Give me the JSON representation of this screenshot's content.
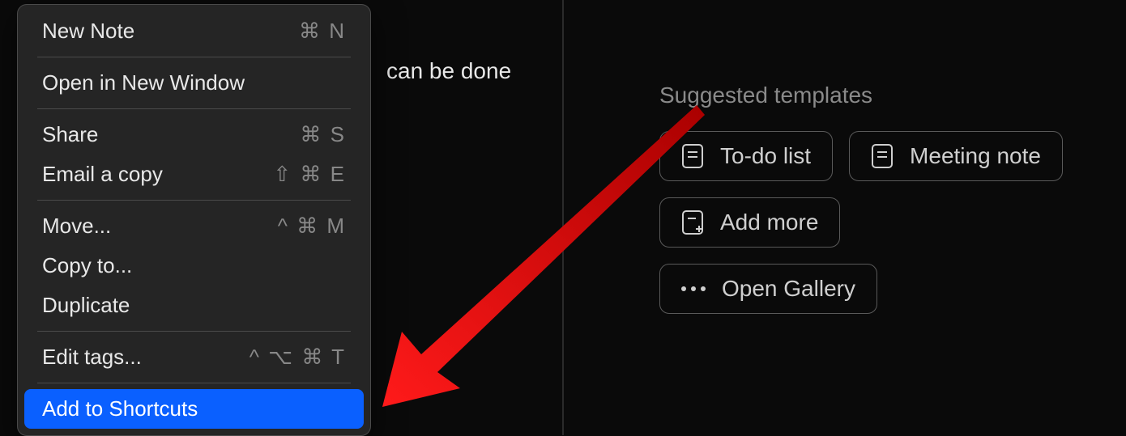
{
  "background": {
    "visible_text_fragment": "can be done"
  },
  "context_menu": {
    "items": [
      {
        "label": "New Note",
        "shortcut": "⌘ N"
      },
      {
        "separator": true
      },
      {
        "label": "Open in New Window"
      },
      {
        "separator": true
      },
      {
        "label": "Share",
        "shortcut": "⌘ S"
      },
      {
        "label": "Email a copy",
        "shortcut": "⇧ ⌘ E"
      },
      {
        "separator": true
      },
      {
        "label": "Move...",
        "shortcut": "^ ⌘ M"
      },
      {
        "label": "Copy to..."
      },
      {
        "label": "Duplicate"
      },
      {
        "separator": true
      },
      {
        "label": "Edit tags...",
        "shortcut": "^ ⌥ ⌘ T"
      },
      {
        "separator": true
      },
      {
        "label": "Add to Shortcuts",
        "highlighted": true
      }
    ]
  },
  "suggested": {
    "title": "Suggested templates",
    "buttons": {
      "todo": "To-do list",
      "meeting": "Meeting note",
      "addmore": "Add more",
      "gallery": "Open Gallery"
    }
  }
}
